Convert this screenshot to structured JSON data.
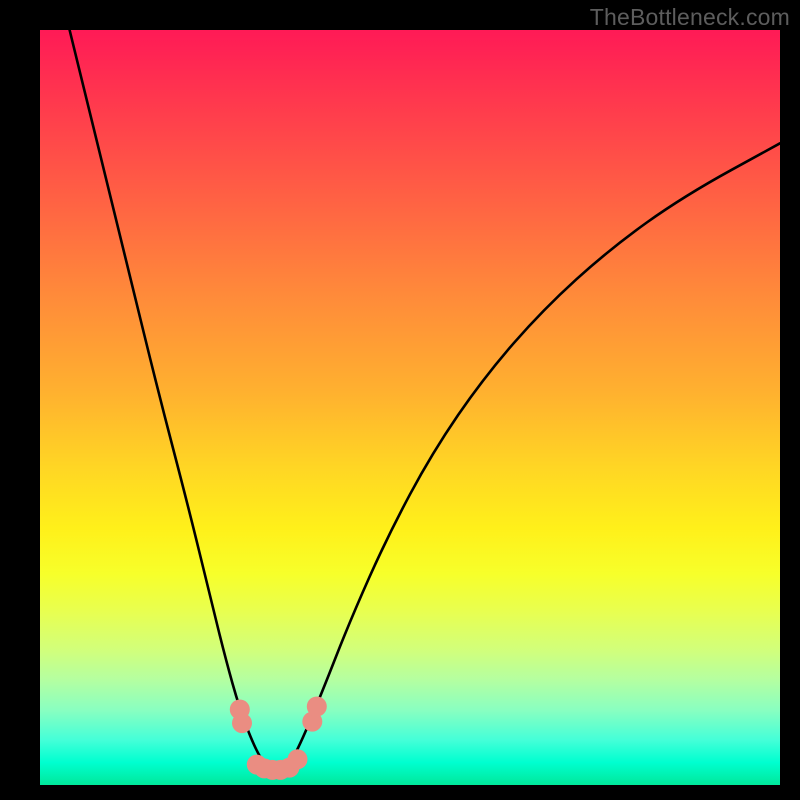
{
  "watermark": "TheBottleneck.com",
  "colors": {
    "page_bg": "#000000",
    "curve_stroke": "#000000",
    "marker_fill": "#ea8d82",
    "marker_stroke": "#d67a70"
  },
  "chart_data": {
    "type": "line",
    "title": "",
    "xlabel": "",
    "ylabel": "",
    "xlim": [
      0,
      100
    ],
    "ylim": [
      0,
      100
    ],
    "background": "rainbow-heat-gradient",
    "series": [
      {
        "name": "bottleneck-curve",
        "x": [
          4,
          8,
          12,
          16,
          20,
          23,
          25,
          27,
          29,
          30.5,
          32,
          33.5,
          35,
          38,
          42,
          47,
          53,
          60,
          68,
          77,
          87,
          100
        ],
        "y": [
          100,
          84,
          68,
          52,
          37,
          25,
          17,
          10,
          5,
          2.5,
          1.5,
          2.5,
          5,
          12,
          22,
          33,
          44,
          54,
          63,
          71,
          78,
          85
        ]
      }
    ],
    "markers": [
      {
        "x": 27.0,
        "y": 10.0
      },
      {
        "x": 27.3,
        "y": 8.2
      },
      {
        "x": 29.3,
        "y": 2.7
      },
      {
        "x": 30.3,
        "y": 2.2
      },
      {
        "x": 31.4,
        "y": 2.0
      },
      {
        "x": 32.5,
        "y": 2.0
      },
      {
        "x": 33.7,
        "y": 2.3
      },
      {
        "x": 34.8,
        "y": 3.4
      },
      {
        "x": 36.8,
        "y": 8.4
      },
      {
        "x": 37.4,
        "y": 10.4
      }
    ],
    "minimum": {
      "x": 32,
      "y": 1.5
    }
  }
}
